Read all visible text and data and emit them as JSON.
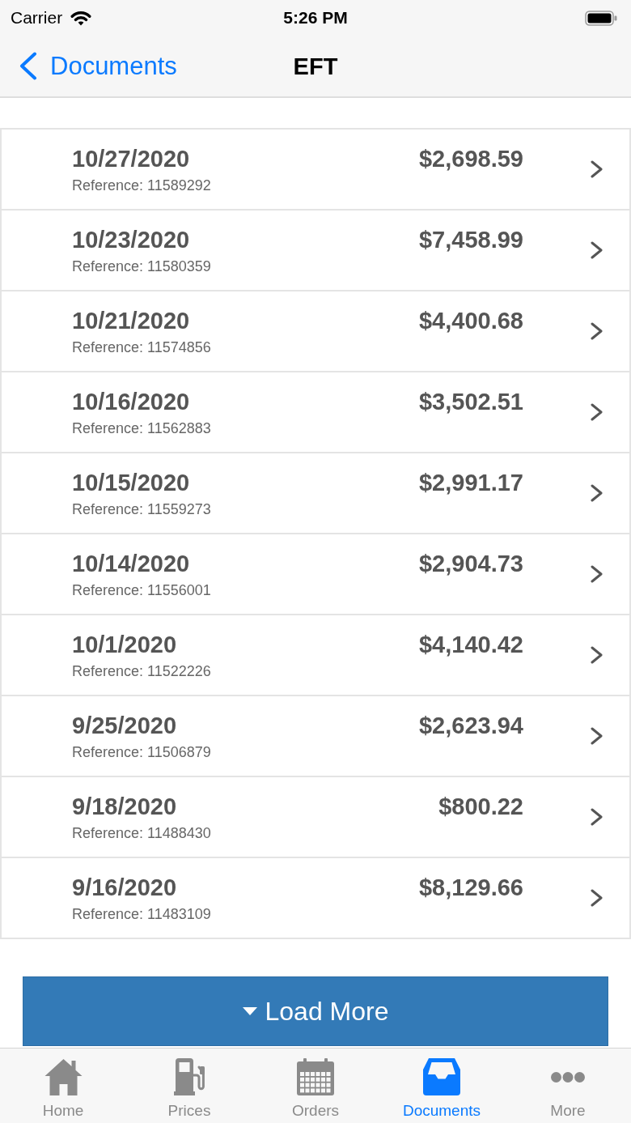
{
  "status_bar": {
    "carrier": "Carrier",
    "time": "5:26 PM"
  },
  "nav_bar": {
    "back_label": "Documents",
    "title": "EFT"
  },
  "transactions": [
    {
      "date": "10/27/2020",
      "reference": "Reference: 11589292",
      "amount": "$2,698.59"
    },
    {
      "date": "10/23/2020",
      "reference": "Reference: 11580359",
      "amount": "$7,458.99"
    },
    {
      "date": "10/21/2020",
      "reference": "Reference: 11574856",
      "amount": "$4,400.68"
    },
    {
      "date": "10/16/2020",
      "reference": "Reference: 11562883",
      "amount": "$3,502.51"
    },
    {
      "date": "10/15/2020",
      "reference": "Reference: 11559273",
      "amount": "$2,991.17"
    },
    {
      "date": "10/14/2020",
      "reference": "Reference: 11556001",
      "amount": "$2,904.73"
    },
    {
      "date": "10/1/2020",
      "reference": "Reference: 11522226",
      "amount": "$4,140.42"
    },
    {
      "date": "9/25/2020",
      "reference": "Reference: 11506879",
      "amount": "$2,623.94"
    },
    {
      "date": "9/18/2020",
      "reference": "Reference: 11488430",
      "amount": "$800.22"
    },
    {
      "date": "9/16/2020",
      "reference": "Reference: 11483109",
      "amount": "$8,129.66"
    }
  ],
  "load_more_button": {
    "label": "Load More"
  },
  "tab_bar": [
    {
      "label": "Home",
      "kind": "home",
      "selected": false
    },
    {
      "label": "Prices",
      "kind": "fuel",
      "selected": false
    },
    {
      "label": "Orders",
      "kind": "calendar",
      "selected": false
    },
    {
      "label": "Documents",
      "kind": "inbox",
      "selected": true
    },
    {
      "label": "More",
      "kind": "more",
      "selected": false
    }
  ]
}
